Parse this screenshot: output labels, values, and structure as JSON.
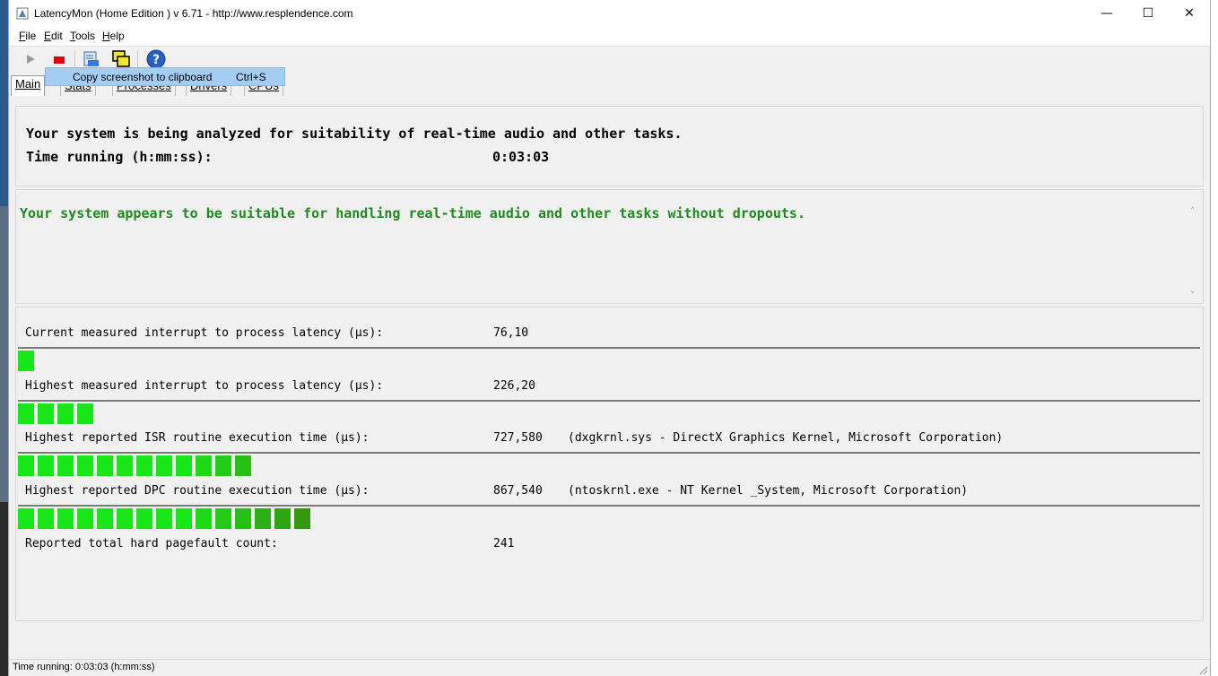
{
  "window": {
    "title": "LatencyMon  (Home Edition )  v 6.71 - http://www.resplendence.com",
    "minimize_glyph": "—",
    "maximize_glyph": "☐",
    "close_glyph": "✕"
  },
  "menu": {
    "file": {
      "key": "F",
      "rest": "ile"
    },
    "edit": {
      "key": "E",
      "rest": "dit"
    },
    "tools": {
      "key": "T",
      "rest": "ools"
    },
    "help": {
      "key": "H",
      "rest": "elp"
    }
  },
  "toolbar": {
    "icons": [
      "play-icon",
      "stop-icon",
      "report-icon",
      "copy-screenshot-icon",
      "help-icon"
    ]
  },
  "tooltip": {
    "label": "Copy screenshot to clipboard",
    "shortcut": "Ctrl+S"
  },
  "tabs": [
    "Main",
    "Stats",
    "Processes",
    "Drivers",
    "CPUs"
  ],
  "status_panel": {
    "line1": "Your system is being analyzed for suitability of real-time audio and other tasks.",
    "line2_label": "Time running (h:mm:ss):",
    "line2_value": "0:03:03"
  },
  "verdict": {
    "message": "Your system appears to be suitable for handling real-time audio and other tasks without dropouts.",
    "color": "#1f8a1f"
  },
  "metrics": [
    {
      "label": "Current measured interrupt to process latency (µs):",
      "value": "76,10",
      "extra": "",
      "bar_segments": 1
    },
    {
      "label": "Highest measured interrupt to process latency (µs):",
      "value": "226,20",
      "extra": "",
      "bar_segments": 4
    },
    {
      "label": "Highest reported ISR routine execution time (µs):",
      "value": "727,580",
      "extra": "(dxgkrnl.sys - DirectX Graphics Kernel, Microsoft Corporation)",
      "bar_segments": 12
    },
    {
      "label": "Highest reported DPC routine execution time (µs):",
      "value": "867,540",
      "extra": "(ntoskrnl.exe - NT Kernel _System, Microsoft Corporation)",
      "bar_segments": 15
    },
    {
      "label": "Reported total hard pagefault count:",
      "value": "241",
      "extra": ""
    }
  ],
  "statusbar": {
    "text": "Time running: 0:03:03  (h:mm:ss)"
  },
  "colors": {
    "bar_bright": "#19e619",
    "bar_dark": "#3b8a10"
  }
}
